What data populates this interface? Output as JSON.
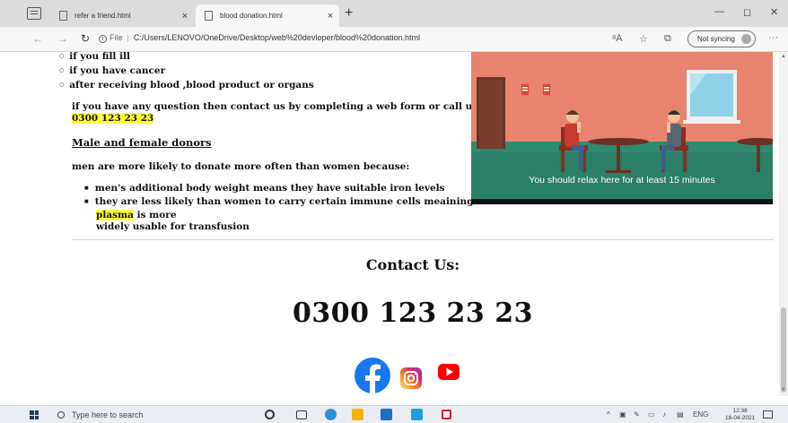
{
  "browser": {
    "tabs": [
      {
        "title": "refer a friend.html"
      },
      {
        "title": "blood donation.html",
        "active": true
      }
    ],
    "new_tab": "+",
    "close_glyph": "×",
    "window": {
      "minimize": "—",
      "restore": "◻",
      "close": "✕"
    },
    "address": {
      "file_label": "File",
      "separator": "|",
      "url": "C:/Users/LENOVO/OneDrive/Desktop/web%20devloper/blood%20donation.html"
    },
    "sync_label": "Not syncing",
    "more": "···"
  },
  "page": {
    "list_top": [
      "if you fill ill",
      "if you have cancer",
      "after receiving blood ,blood product or organs"
    ],
    "question_text": "if you have any question then contact us by completing a web form or call us on",
    "question_phone": "0300 123 23 23",
    "subheading": "Male and female donors",
    "intro": "men are more likely to donate more often than women because:",
    "list_bottom": {
      "item1": "men's additional body weight means they have suitable iron levels",
      "item2_part1": "they are less likely than women to carry certain immune cells meaining there",
      "item2_highlight": "plasma",
      "item2_part2": " is more",
      "item2_part3": "widely usable for transfusion"
    },
    "hero_caption": "You should relax here for at least 15 minutes",
    "contact_title": "Contact Us:",
    "contact_phone": "0300 123 23 23",
    "social_icons": [
      "facebook-icon",
      "instagram-icon",
      "youtube-icon"
    ]
  },
  "taskbar": {
    "search_placeholder": "Type here to search",
    "language": "ENG",
    "time": "12:38",
    "date": "18-04-2021"
  },
  "colors": {
    "highlight": "#ffff3d",
    "hero_wall": "#e8836f",
    "hero_floor": "#2f8a6f",
    "facebook": "#1877f2",
    "youtube": "#ff0000"
  }
}
